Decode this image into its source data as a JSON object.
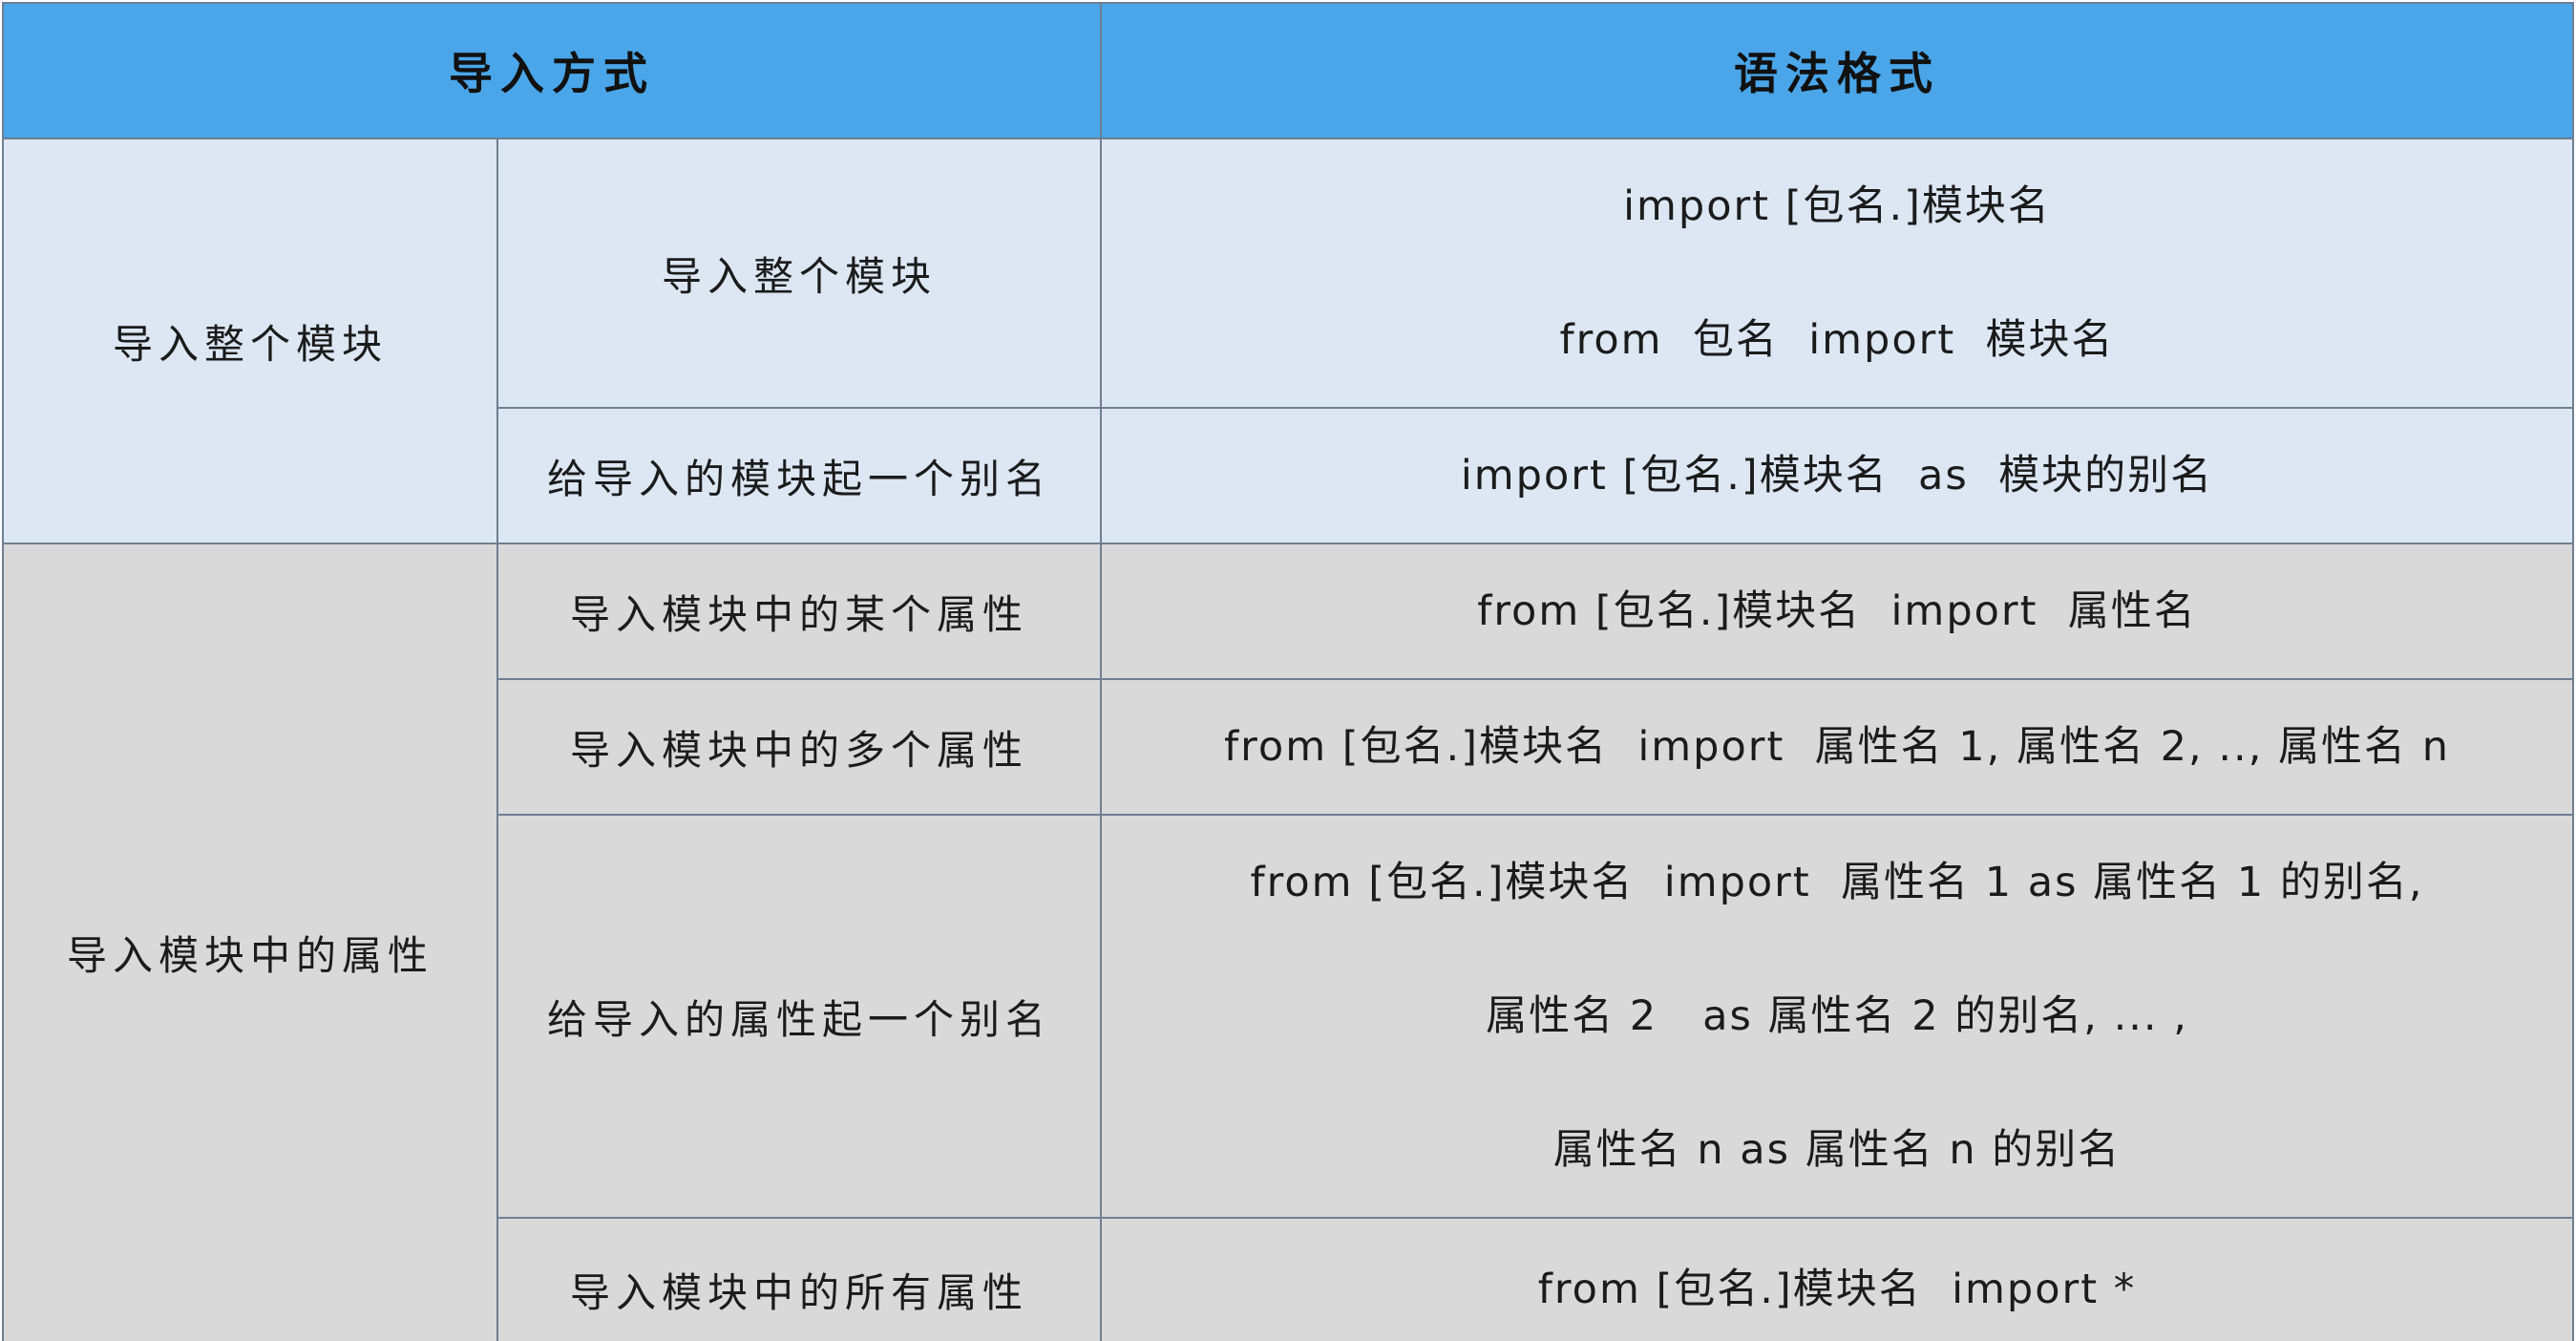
{
  "header": {
    "col_method": "导入方式",
    "col_syntax": "语法格式"
  },
  "groups": [
    {
      "category": "导入整个模块",
      "rows": [
        {
          "method": "导入整个模块",
          "syntax": [
            "import [包名.]模块名",
            "from  包名  import  模块名"
          ]
        },
        {
          "method": "给导入的模块起一个别名",
          "syntax": [
            "import [包名.]模块名  as  模块的别名"
          ]
        }
      ]
    },
    {
      "category": "导入模块中的属性",
      "rows": [
        {
          "method": "导入模块中的某个属性",
          "syntax": [
            "from [包名.]模块名  import  属性名"
          ]
        },
        {
          "method": "导入模块中的多个属性",
          "syntax": [
            "from [包名.]模块名  import  属性名 1, 属性名 2, .., 属性名 n"
          ]
        },
        {
          "method": "给导入的属性起一个别名",
          "syntax": [
            "from [包名.]模块名  import  属性名 1 as 属性名 1 的别名,",
            "属性名 2   as 属性名 2 的别名, ... ,",
            "属性名 n as 属性名 n 的别名"
          ]
        },
        {
          "method": "导入模块中的所有属性",
          "syntax": [
            "from [包名.]模块名  import *"
          ]
        }
      ]
    }
  ]
}
